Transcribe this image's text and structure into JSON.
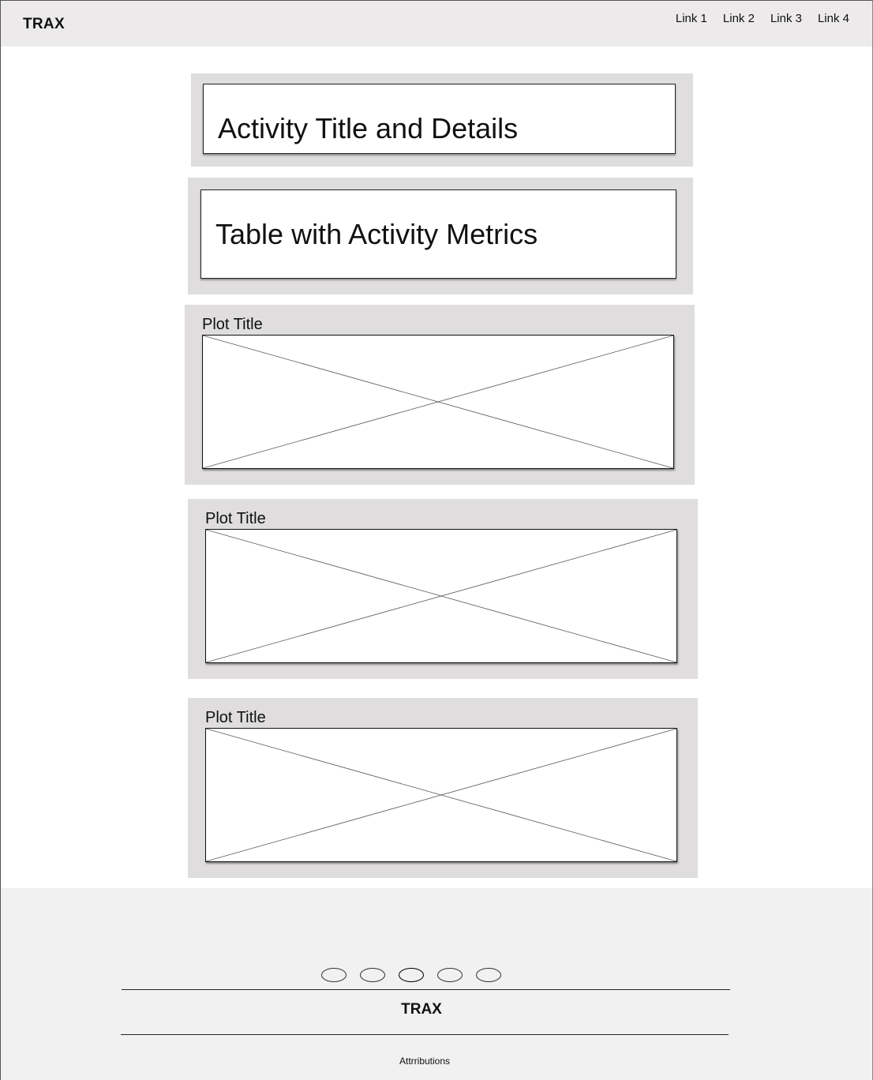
{
  "header": {
    "brand": "TRAX",
    "links": [
      "Link 1",
      "Link 2",
      "Link 3",
      "Link 4"
    ]
  },
  "main": {
    "activity_title": "Activity Title and Details",
    "metrics_table": "Table with Activity Metrics",
    "plots": [
      {
        "title": "Plot Title"
      },
      {
        "title": "Plot Title"
      },
      {
        "title": "Plot Title"
      }
    ]
  },
  "footer": {
    "carousel_dots": 5,
    "active_dot": 3,
    "brand": "TRAX",
    "attributions": "Attrributions"
  }
}
